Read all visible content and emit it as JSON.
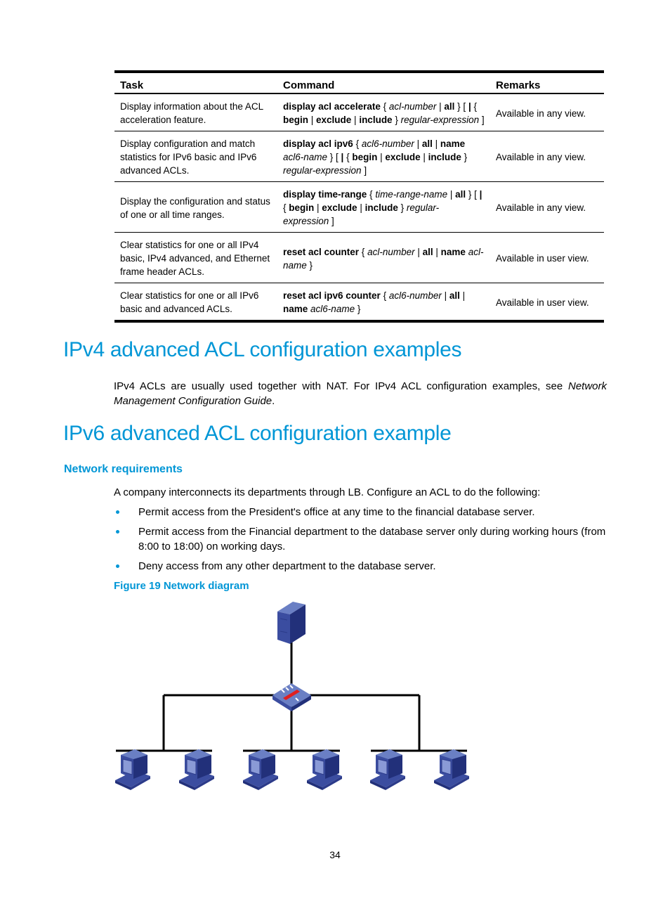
{
  "table": {
    "headers": [
      "Task",
      "Command",
      "Remarks"
    ],
    "rows": [
      {
        "task": "Display information about the ACL acceleration feature.",
        "command": [
          {
            "t": "display acl accelerate",
            "s": "b"
          },
          {
            "t": " { ",
            "s": ""
          },
          {
            "t": "acl-number",
            "s": "i"
          },
          {
            "t": " | ",
            "s": ""
          },
          {
            "t": "all",
            "s": "b"
          },
          {
            "t": " } [ ",
            "s": ""
          },
          {
            "t": "|",
            "s": "b"
          },
          {
            "t": " { ",
            "s": ""
          },
          {
            "t": "begin",
            "s": "b"
          },
          {
            "t": " | ",
            "s": ""
          },
          {
            "t": "exclude",
            "s": "b"
          },
          {
            "t": " | ",
            "s": ""
          },
          {
            "t": "include",
            "s": "b"
          },
          {
            "t": " } ",
            "s": ""
          },
          {
            "t": "regular-expression",
            "s": "i"
          },
          {
            "t": " ]",
            "s": ""
          }
        ],
        "remarks": "Available in any view."
      },
      {
        "task": "Display configuration and match statistics for IPv6 basic and IPv6 advanced ACLs.",
        "command": [
          {
            "t": "display acl ipv6",
            "s": "b"
          },
          {
            "t": " { ",
            "s": ""
          },
          {
            "t": "acl6-number",
            "s": "i"
          },
          {
            "t": " | ",
            "s": ""
          },
          {
            "t": "all",
            "s": "b"
          },
          {
            "t": " | ",
            "s": ""
          },
          {
            "t": "name",
            "s": "b"
          },
          {
            "t": " ",
            "s": ""
          },
          {
            "t": "acl6-name",
            "s": "i"
          },
          {
            "t": " } [ ",
            "s": ""
          },
          {
            "t": "|",
            "s": "b"
          },
          {
            "t": " { ",
            "s": ""
          },
          {
            "t": "begin",
            "s": "b"
          },
          {
            "t": " | ",
            "s": ""
          },
          {
            "t": "exclude",
            "s": "b"
          },
          {
            "t": " | ",
            "s": ""
          },
          {
            "t": "include",
            "s": "b"
          },
          {
            "t": " } ",
            "s": ""
          },
          {
            "t": "regular-expression",
            "s": "i"
          },
          {
            "t": " ]",
            "s": ""
          }
        ],
        "remarks": "Available in any view."
      },
      {
        "task": "Display the configuration and status of one or all time ranges.",
        "command": [
          {
            "t": "display time-range",
            "s": "b"
          },
          {
            "t": " { ",
            "s": ""
          },
          {
            "t": "time-range-name",
            "s": "i"
          },
          {
            "t": " | ",
            "s": ""
          },
          {
            "t": "all",
            "s": "b"
          },
          {
            "t": " } [ ",
            "s": ""
          },
          {
            "t": "|",
            "s": "b"
          },
          {
            "t": " { ",
            "s": ""
          },
          {
            "t": "begin",
            "s": "b"
          },
          {
            "t": " | ",
            "s": ""
          },
          {
            "t": "exclude",
            "s": "b"
          },
          {
            "t": " | ",
            "s": ""
          },
          {
            "t": "include",
            "s": "b"
          },
          {
            "t": " } ",
            "s": ""
          },
          {
            "t": "regular-expression",
            "s": "i"
          },
          {
            "t": " ]",
            "s": ""
          }
        ],
        "remarks": "Available in any view."
      },
      {
        "task": "Clear statistics for one or all IPv4 basic, IPv4 advanced, and Ethernet frame header ACLs.",
        "command": [
          {
            "t": "reset acl counter",
            "s": "b"
          },
          {
            "t": " { ",
            "s": ""
          },
          {
            "t": "acl-number",
            "s": "i"
          },
          {
            "t": " | ",
            "s": ""
          },
          {
            "t": "all",
            "s": "b"
          },
          {
            "t": " | ",
            "s": ""
          },
          {
            "t": "name",
            "s": "b"
          },
          {
            "t": " ",
            "s": ""
          },
          {
            "t": "acl-name",
            "s": "i"
          },
          {
            "t": " }",
            "s": ""
          }
        ],
        "remarks": "Available in user view."
      },
      {
        "task": "Clear statistics for one or all IPv6 basic and advanced ACLs.",
        "command": [
          {
            "t": "reset acl ipv6 counter",
            "s": "b"
          },
          {
            "t": " { ",
            "s": ""
          },
          {
            "t": "acl6-number",
            "s": "i"
          },
          {
            "t": " | ",
            "s": ""
          },
          {
            "t": "all",
            "s": "b"
          },
          {
            "t": " | ",
            "s": ""
          },
          {
            "t": "name",
            "s": "b"
          },
          {
            "t": " ",
            "s": ""
          },
          {
            "t": "acl6-name",
            "s": "i"
          },
          {
            "t": " }",
            "s": ""
          }
        ],
        "remarks": "Available in user view."
      }
    ]
  },
  "section_ipv4": {
    "heading": "IPv4 advanced ACL configuration examples",
    "paragraph_plain": "IPv4 ACLs are usually used together with NAT. For IPv4 ACL configuration examples, see ",
    "paragraph_italic": "Network Management Configuration Guide",
    "paragraph_end": "."
  },
  "section_ipv6": {
    "heading": "IPv6 advanced ACL configuration example",
    "subheading": "Network requirements",
    "intro": "A company interconnects its departments through LB. Configure an ACL to do the following:",
    "bullets": [
      "Permit access from the President's office at any time to the financial database server.",
      "Permit access from the Financial department to the database server only during working hours (from 8:00 to 18:00) on working days.",
      "Deny access from any other department to the database server."
    ],
    "figure_caption": "Figure 19 Network diagram"
  },
  "diagram": {
    "icons": {
      "server": "server-icon",
      "device": "load-balancer-icon",
      "host": "pc-icon"
    },
    "colors": {
      "device_blue": "#3b4da0",
      "device_light": "#6a7fc4",
      "device_dark": "#22307a",
      "accent_red": "#e02020",
      "line": "#000000"
    },
    "host_count": 6,
    "segment_count": 3
  },
  "page_number": "34",
  "colors": {
    "heading_blue": "#0096d6"
  }
}
